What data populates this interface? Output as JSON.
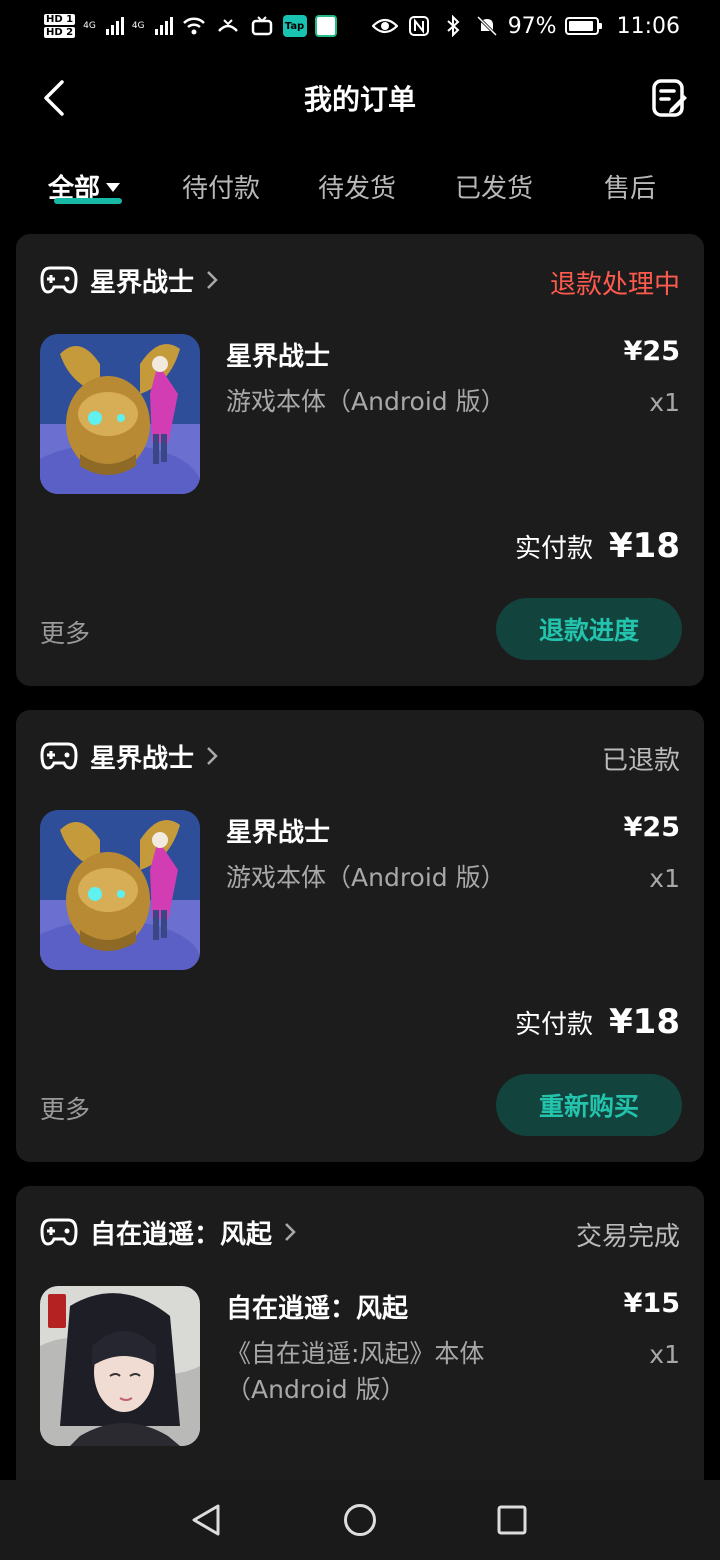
{
  "status_bar": {
    "hd1": "HD 1",
    "hd2": "HD 2",
    "net1": "4G",
    "net2": "4G",
    "tap_badge": "Tap",
    "battery": "97%",
    "time": "11:06"
  },
  "header": {
    "title": "我的订单"
  },
  "tabs": [
    {
      "label": "全部"
    },
    {
      "label": "待付款"
    },
    {
      "label": "待发货"
    },
    {
      "label": "已发货"
    },
    {
      "label": "售后"
    }
  ],
  "colors": {
    "accent": "#17b8a6",
    "status_red": "#ff5a4e",
    "button_bg": "#12433c",
    "card_bg": "#1c1c1c"
  },
  "orders": [
    {
      "store": "星界战士",
      "status": "退款处理中",
      "item_title": "星界战士",
      "item_desc": "游戏本体（Android 版）",
      "price": "¥25",
      "qty": "x1",
      "paid_label": "实付款",
      "paid_amount": "¥18",
      "more": "更多",
      "action": "退款进度"
    },
    {
      "store": "星界战士",
      "status": "已退款",
      "item_title": "星界战士",
      "item_desc": "游戏本体（Android 版）",
      "price": "¥25",
      "qty": "x1",
      "paid_label": "实付款",
      "paid_amount": "¥18",
      "more": "更多",
      "action": "重新购买"
    },
    {
      "store": "自在逍遥：风起",
      "status": "交易完成",
      "item_title": "自在逍遥：风起",
      "item_desc_line1": "《自在逍遥:风起》本体",
      "item_desc_line2": "（Android 版）",
      "price": "¥15",
      "qty": "x1"
    }
  ]
}
